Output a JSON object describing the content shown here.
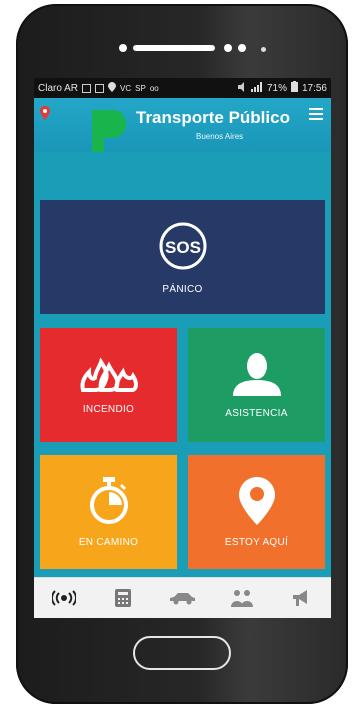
{
  "status_bar": {
    "carrier": "Claro AR",
    "icons_left": [
      "photo-icon",
      "mail-icon",
      "location-icon"
    ],
    "vc_text": "VC",
    "sp_text": "SP",
    "oo_text": "oo",
    "battery_text": "71%",
    "time": "17:56"
  },
  "app_bar": {
    "title": "Transporte Público",
    "subtitle": "Buenos Aires",
    "brand_color": "#1da1c4",
    "logo_color": "#19b44c"
  },
  "tiles": [
    {
      "id": "panico",
      "label": "PÁNICO",
      "icon": "sos-icon",
      "color": "#273a67"
    },
    {
      "id": "incendio",
      "label": "INCENDIO",
      "icon": "fire-icon",
      "color": "#e52b2e"
    },
    {
      "id": "asistencia",
      "label": "ASISTENCIA",
      "icon": "person-icon",
      "color": "#1d9c64"
    },
    {
      "id": "en_camino",
      "label": "EN CAMINO",
      "icon": "stopwatch-icon",
      "color": "#f7a61c"
    },
    {
      "id": "estoy_aqui",
      "label": "ESTOY AQUÍ",
      "icon": "map-pin-icon",
      "color": "#f0702c"
    }
  ],
  "sos_text": "SOS",
  "bottom_nav": [
    {
      "icon": "broadcast-icon",
      "active": true
    },
    {
      "icon": "calculator-icon",
      "active": false
    },
    {
      "icon": "car-icon",
      "active": false
    },
    {
      "icon": "group-icon",
      "active": false
    },
    {
      "icon": "megaphone-icon",
      "active": false
    }
  ]
}
